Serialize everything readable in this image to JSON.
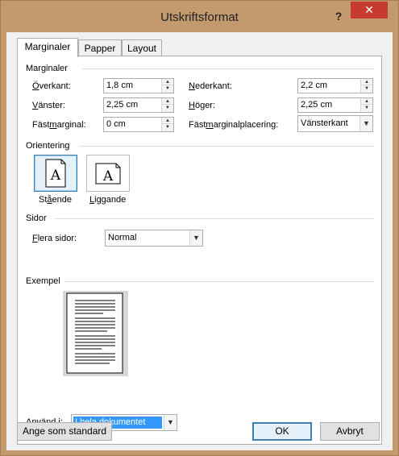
{
  "window": {
    "title": "Utskriftsformat",
    "help_label": "?",
    "close_label": "✕"
  },
  "tabs": [
    "Marginaler",
    "Papper",
    "Layout"
  ],
  "margins": {
    "section_label": "Marginaler",
    "top": {
      "label_pre": "",
      "label_u": "Ö",
      "label_post": "verkant:",
      "value": "1,8 cm"
    },
    "bottom": {
      "label_pre": "",
      "label_u": "N",
      "label_post": "ederkant:",
      "value": "2,2 cm"
    },
    "left": {
      "label_pre": "",
      "label_u": "V",
      "label_post": "änster:",
      "value": "2,25 cm"
    },
    "right": {
      "label_pre": "",
      "label_u": "H",
      "label_post": "öger:",
      "value": "2,25 cm"
    },
    "gutter": {
      "label_pre": "Fäst",
      "label_u": "m",
      "label_post": "arginal:",
      "value": "0 cm"
    },
    "gutter_pos": {
      "label_pre": "Fäst",
      "label_u": "m",
      "label_post": "arginalplacering:",
      "value": "Vänsterkant"
    }
  },
  "orientation": {
    "section_label": "Orientering",
    "portrait": {
      "label_pre": "St",
      "label_u": "å",
      "label_post": "ende",
      "glyph": "A"
    },
    "landscape": {
      "label_pre": "",
      "label_u": "L",
      "label_post": "iggande",
      "glyph": "A"
    }
  },
  "pages": {
    "section_label": "Sidor",
    "multiple_label_pre": "",
    "multiple_label_u": "F",
    "multiple_label_post": "lera sidor:",
    "multiple_value": "Normal"
  },
  "preview": {
    "section_label": "Exempel"
  },
  "apply": {
    "label_pre": "Använ",
    "label_u": "d",
    "label_post": " i:",
    "value": "I hela dokumentet"
  },
  "footer": {
    "default_label": "Ange som standard",
    "ok_label": "OK",
    "cancel_label": "Avbryt"
  },
  "colors": {
    "close": "#c73a2e",
    "frame": "#c39a6e",
    "selection": "#3399ff"
  }
}
